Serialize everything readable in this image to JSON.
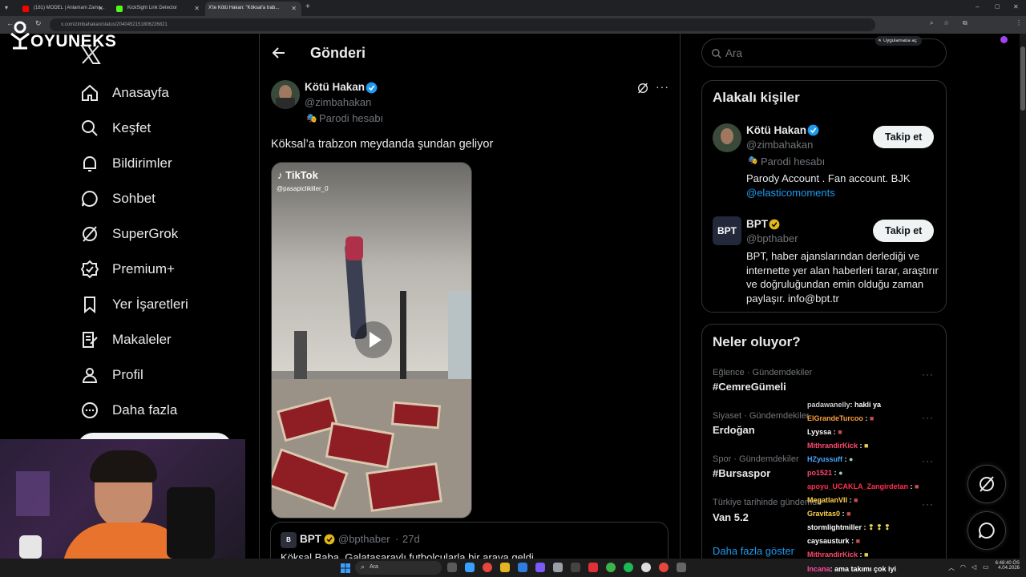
{
  "browser": {
    "tabs": [
      {
        "title": "(181) MODEL | Anlamam Zama...",
        "active": false,
        "icon_color": "#ff0000"
      },
      {
        "title": "KickSight Link Detector",
        "active": false,
        "icon_color": "#53fc18"
      },
      {
        "title": "X'te Kötü Hakan: \"Köksal'a trab...",
        "active": true,
        "icon_color": "#ffffff"
      }
    ],
    "url": "x.com/zimbahakan/status/2040452151806226821",
    "app_chip": "Uygulamada aç"
  },
  "overlay_logo": "OYUNEKS",
  "nav": {
    "items": [
      {
        "label": "Anasayfa",
        "icon": "home-icon"
      },
      {
        "label": "Keşfet",
        "icon": "search-icon"
      },
      {
        "label": "Bildirimler",
        "icon": "bell-icon"
      },
      {
        "label": "Sohbet",
        "icon": "chat-icon"
      },
      {
        "label": "SuperGrok",
        "icon": "grok-icon"
      },
      {
        "label": "Premium+",
        "icon": "verified-icon"
      },
      {
        "label": "Yer İşaretleri",
        "icon": "bookmark-icon"
      },
      {
        "label": "Makaleler",
        "icon": "article-icon"
      },
      {
        "label": "Profil",
        "icon": "person-icon"
      },
      {
        "label": "Daha fazla",
        "icon": "more-icon"
      }
    ]
  },
  "post": {
    "header_title": "Gönderi",
    "author_name": "Kötü Hakan",
    "author_handle": "@zimbahakan",
    "parody_label": "Parodi hesabı",
    "text": "Köksal’a trabzon meydanda şundan geliyor",
    "video_source": "TikTok",
    "video_user": "@pasapiclikliler_0",
    "quote": {
      "name": "BPT",
      "handle": "@bpthaber",
      "time": "27d",
      "text": "Köksal Baba, Galatasaraylı futbolcularla bir araya geldi"
    }
  },
  "search": {
    "placeholder": "Ara"
  },
  "related": {
    "title": "Alakalı kişiler",
    "people": [
      {
        "name": "Kötü Hakan",
        "handle": "@zimbahakan",
        "badge": "Parodi hesabı",
        "bio": "Parody Account . Fan account. BJK",
        "link": "@elasticomoments",
        "follow": "Takip et"
      },
      {
        "name": "BPT",
        "handle": "@bpthaber",
        "bio": "BPT, haber ajanslarından derlediği ve internette yer alan haberleri tarar, araştırır ve doğruluğundan emin olduğu zaman paylaşır. info@bpt.tr",
        "follow": "Takip et"
      }
    ]
  },
  "trends": {
    "title": "Neler oluyor?",
    "items": [
      {
        "category": "Eğlence · Gündemdekiler",
        "name": "#CemreGümeli"
      },
      {
        "category": "Siyaset · Gündemdekiler",
        "name": "Erdoğan"
      },
      {
        "category": "Spor · Gündemdekiler",
        "name": "#Bursaspor"
      },
      {
        "category": "Türkiye tarihinde gündemde",
        "name": "Van 5.2"
      }
    ],
    "show_more": "Daha fazla göster"
  },
  "chat": [
    {
      "user": "padawanelly",
      "msg": ": hakli ya",
      "color": "#cccccc"
    },
    {
      "user": "ElGrandeTurcoo",
      "msg": ":",
      "color": "#ff9f40"
    },
    {
      "user": "Lyyssa",
      "msg": ":",
      "color": "#ffffff"
    },
    {
      "user": "MithrandirKick",
      "msg": ":",
      "color": "#ff4a6e"
    },
    {
      "user": "HZyussuff",
      "msg": ":",
      "color": "#4aa8ff"
    },
    {
      "user": "po1521",
      "msg": ":",
      "color": "#ff4a6e"
    },
    {
      "user": "apoyu_UCAKLA_Zangirdetan",
      "msg": ":",
      "color": "#ff3050"
    },
    {
      "user": "MegatlanVII",
      "msg": ":",
      "color": "#ffd14a"
    },
    {
      "user": "Gravitas0",
      "msg": ":",
      "color": "#ffd14a"
    },
    {
      "user": "stormlightmiller",
      "msg": ":",
      "color": "#ffffff"
    },
    {
      "user": "caysausturk",
      "msg": ":",
      "color": "#ffffff"
    },
    {
      "user": "MithrandirKick",
      "msg": ":",
      "color": "#ff4a6e"
    },
    {
      "user": "Incana",
      "msg": ": ama takımı çok iyi",
      "color": "#ff4aa0"
    }
  ],
  "taskbar": {
    "search": "Ara",
    "time": "6:48:40 ÖS",
    "date": "4.04.2026"
  },
  "colors": {
    "accent": "#1d9bf0",
    "gold": "#e2b719",
    "bg": "#000000",
    "border": "#2f3336"
  }
}
